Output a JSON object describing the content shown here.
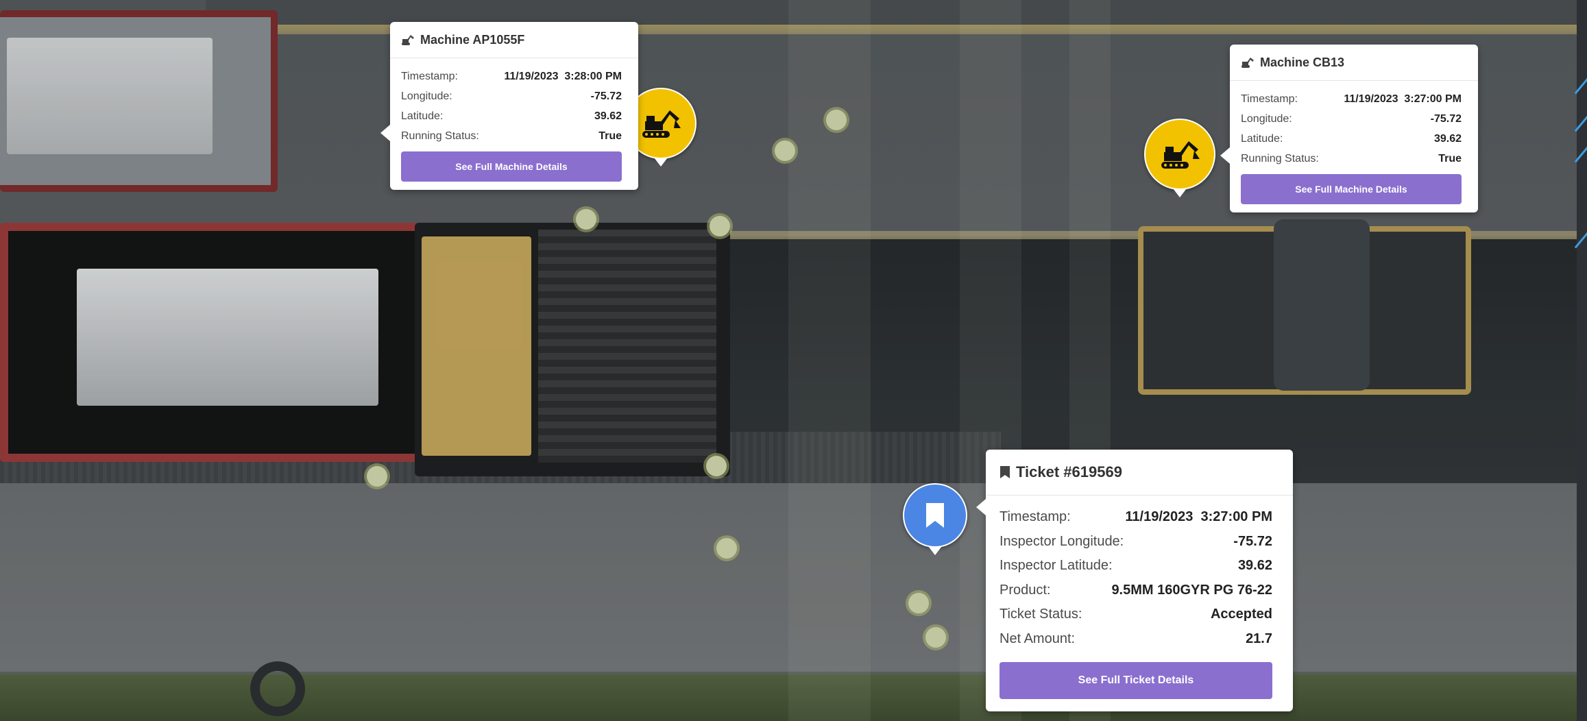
{
  "machines": [
    {
      "title": "Machine AP1055F",
      "rows": [
        {
          "label": "Timestamp:",
          "value": "11/19/2023  3:28:00 PM"
        },
        {
          "label": "Longitude:",
          "value": "-75.72"
        },
        {
          "label": "Latitude:",
          "value": "39.62"
        },
        {
          "label": "Running Status:",
          "value": "True"
        }
      ],
      "button": "See Full Machine Details"
    },
    {
      "title": "Machine CB13",
      "rows": [
        {
          "label": "Timestamp:",
          "value": "11/19/2023  3:27:00 PM"
        },
        {
          "label": "Longitude:",
          "value": "-75.72"
        },
        {
          "label": "Latitude:",
          "value": "39.62"
        },
        {
          "label": "Running Status:",
          "value": "True"
        }
      ],
      "button": "See Full Machine Details"
    }
  ],
  "ticket": {
    "title": "Ticket #619569",
    "rows": [
      {
        "label": "Timestamp:",
        "value": "11/19/2023  3:27:00 PM"
      },
      {
        "label": "Inspector Longitude:",
        "value": "-75.72"
      },
      {
        "label": "Inspector Latitude:",
        "value": "39.62"
      },
      {
        "label": "Product:",
        "value": "9.5MM 160GYR PG 76-22"
      },
      {
        "label": "Ticket Status:",
        "value": "Accepted"
      },
      {
        "label": "Net Amount:",
        "value": "21.7"
      }
    ],
    "button": "See Full Ticket Details"
  },
  "colors": {
    "machine_marker": "#f2c200",
    "ticket_marker": "#4b86e4",
    "button": "#8a6fcf"
  },
  "icons": {
    "machine": "excavator-icon",
    "ticket": "bookmark-icon"
  }
}
